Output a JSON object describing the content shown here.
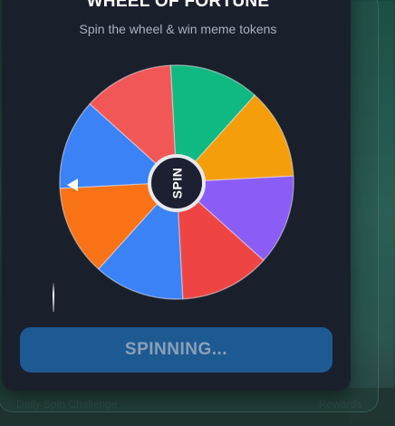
{
  "modal": {
    "title": "WHEEL OF FORTUNE",
    "subtitle": "Spin the wheel & win meme tokens"
  },
  "wheel": {
    "hub_label": "SPIN",
    "segments": [
      {
        "color": "#10b981"
      },
      {
        "color": "#f59e0b"
      },
      {
        "color": "#8b5cf6"
      },
      {
        "color": "#ef4444"
      },
      {
        "color": "#3b82f6"
      },
      {
        "color": "#f97316"
      },
      {
        "color": "#3b82f6"
      },
      {
        "color": "#f25757"
      }
    ],
    "rotation_deg": -3
  },
  "spin_button": {
    "label": "SPINNING..."
  },
  "background": {
    "footer_left": "Daily Spin Challenge",
    "footer_right": "Rewards"
  }
}
